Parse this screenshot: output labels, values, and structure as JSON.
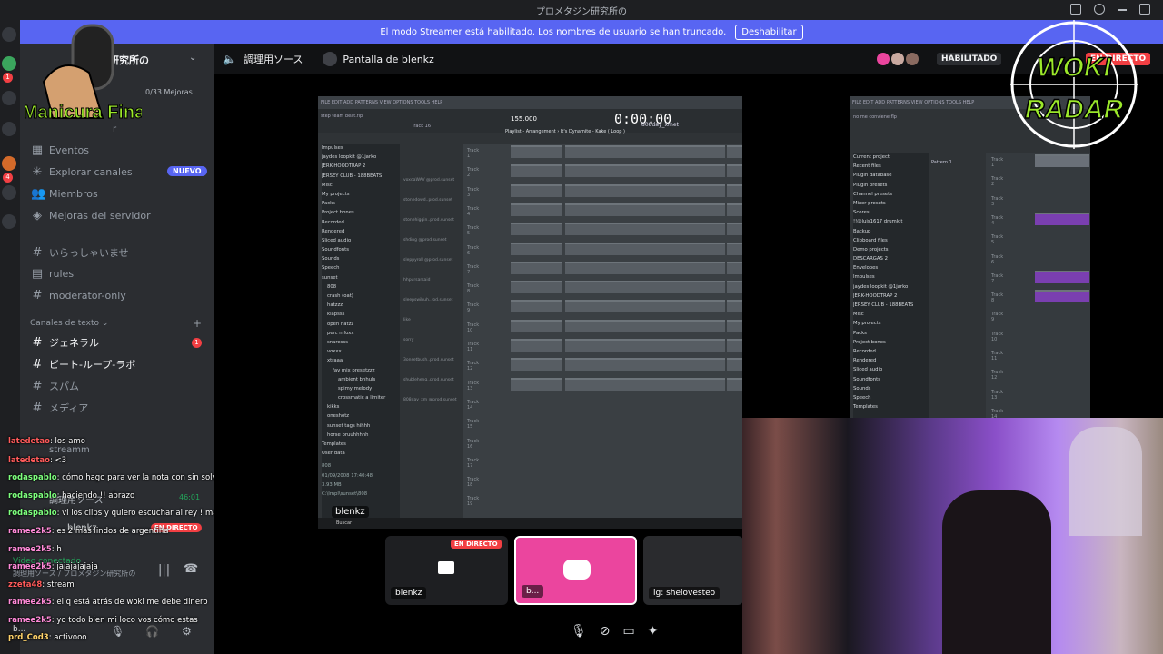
{
  "window": {
    "title": "プロメタジン研究所の"
  },
  "streamer_banner": {
    "text": "El modo Streamer está habilitado. Los nombres de usuario se han truncado.",
    "button": "Deshabilitar"
  },
  "server_badges": {
    "unread1": "1",
    "unread4": "4"
  },
  "server": {
    "name": "研究所の",
    "boosts": "0/33 Mejoras",
    "guide_partial": "r"
  },
  "sidebar": {
    "items": [
      {
        "label": "Eventos",
        "icon": "calendar-icon"
      },
      {
        "label": "Explorar canales",
        "icon": "compass-icon",
        "badge": "NUEVO"
      },
      {
        "label": "Miembros",
        "icon": "members-icon"
      },
      {
        "label": "Mejoras del servidor",
        "icon": "boost-icon"
      }
    ],
    "channels_top": [
      "いらっしゃいませ",
      "rules",
      "moderator-only"
    ],
    "category": "Canales de texto",
    "text_channels": [
      {
        "name": "ジェネラル",
        "mentions": "1"
      },
      {
        "name": "ビート-ループ-ラボ"
      },
      {
        "name": "スパム"
      },
      {
        "name": "メディア"
      }
    ],
    "voice_name": "調理用ソース",
    "voice_timer": "46:01",
    "voice_user": "blenkz",
    "live_badge": "EN DIRECTO",
    "stream_user": "streamm"
  },
  "voice_panel": {
    "status": "Video conectado",
    "channel": "調理用ソース / プロメタジン研究所の",
    "self_short": "b..."
  },
  "chat": [
    {
      "user": "latedetao",
      "msg": "los amo"
    },
    {
      "user": "latedetao",
      "msg": "<3"
    },
    {
      "user": "rodaspablo",
      "msg": "cómo hago para ver la nota con sin solvente?"
    },
    {
      "user": "rodaspablo",
      "msg": "haciendo !! abrazo"
    },
    {
      "user": "rodaspablo",
      "msg": "vi los clips y quiero escuchar al rey ! máquina Cristian"
    },
    {
      "user": "ramee2k5",
      "msg": "es 2 más lindos de argentina"
    },
    {
      "user": "ramee2k5",
      "msg": "h"
    },
    {
      "user": "ramee2k5",
      "msg": "jajajajajaja"
    },
    {
      "user": "zzeta48",
      "msg": "stream"
    },
    {
      "user": "ramee2k5",
      "msg": "el q está atrás de woki me debe dinero"
    },
    {
      "user": "ramee2k5",
      "msg": "yo todo bien mi loco vos cómo estas"
    },
    {
      "user": "prd_Cod3",
      "msg": "activooo"
    }
  ],
  "topbar": {
    "voice_channel": "調理用ソース",
    "stream_title": "Pantalla de blenkz",
    "status": "HABILITADO",
    "live": "EN DIRECTO"
  },
  "daw": {
    "menu": "FILE EDIT ADD PATTERNS VIEW OPTIONS TOOLS HELP",
    "bpm": "155.000",
    "time": "0:00:00",
    "project": "step team beat.flp",
    "track": "Track 16",
    "playlist_title": "Playlist - Arrangement › It's Dynamite - Kake ( Loop )",
    "pattern": "808day_xmet",
    "browser": [
      "Impulses",
      "jaydes loopkit @1jarko",
      "JERK-HOODTRAP 2",
      "JERSEY CLUB - 188BEATS",
      "Misc",
      "My projects",
      "Packs",
      "Project bones",
      "Recorded",
      "Rendered",
      "Sliced audio",
      "Soundfonts",
      "Sounds",
      "Speech",
      "sunset",
      "808",
      "crash (oat)",
      "hatzzz",
      "klapsss",
      "open hatzz",
      "perc n foxx",
      "snaresss",
      "voxxx",
      "xtraaa",
      "fav mix presetzzz",
      "ambient bhhuls",
      "spimy melody",
      "crossmatic a limiter",
      "kikks",
      "oneshotz",
      "sunset tags hihhh",
      "horse bruuhhhhh",
      "Templates",
      "User data"
    ],
    "patterns": [
      "voxdaWAV @prod.sunset",
      "stonedowd..prod.sunset",
      "stonehiggin..prod.sunset",
      "shding @prod.sunset",
      "sleppyroll @prod.sunset",
      "hhpursarsaid",
      "sleepswihuh..rod.sunset",
      "like",
      "sorry",
      "3onsetbush..prod.sunset",
      "shubleheng..prod.sunset",
      "808day_xm @prod.sunset"
    ],
    "tracks": [
      "Track 1",
      "Track 2",
      "Track 3",
      "Track 4",
      "Track 5",
      "Track 6",
      "Track 7",
      "Track 8",
      "Track 9",
      "Track 10",
      "Track 11",
      "Track 12",
      "Track 13",
      "Track 14",
      "Track 15",
      "Track 16",
      "Track 17",
      "Track 18",
      "Track 19"
    ],
    "info": {
      "title": "808",
      "date": "01/09/2008 17:40:48",
      "size": "3.93 MB",
      "path": "C:\\Impl\\sunset\\808"
    },
    "taskbar_search": "Buscar"
  },
  "daw2": {
    "menu": "FILE EDIT ADD PATTERNS VIEW OPTIONS TOOLS HELP",
    "project": "no me conviene.flp",
    "pattern": "Pattern 1",
    "browser": [
      "Current project",
      "Recent files",
      "Plugin database",
      "Plugin presets",
      "Channel presets",
      "Mixer presets",
      "Scores",
      "!!@luis1617 drumkit",
      "Backup",
      "Clipboard files",
      "Demo projects",
      "DESCARGAS 2",
      "Envelopes",
      "Impulses",
      "jaydes loopkit @1jarko",
      "JERK-HOODTRAP 2",
      "JERSEY CLUB - 188BEATS",
      "Misc",
      "My projects",
      "Packs",
      "Project bones",
      "Recorded",
      "Rendered",
      "Sliced audio",
      "Soundfonts",
      "Sounds",
      "Speech",
      "Templates"
    ],
    "tracks": [
      "Track 1",
      "Track 2",
      "Track 3",
      "Track 4",
      "Track 5",
      "Track 6",
      "Track 7",
      "Track 8",
      "Track 9",
      "Track 10",
      "Track 11",
      "Track 12",
      "Track 13",
      "Track 14"
    ],
    "clip_label": "no me conviene_2306"
  },
  "tiles": [
    {
      "label": "blenkz",
      "live": "EN DIRECTO"
    },
    {
      "label": "b..."
    },
    {
      "label": "lg: shelovesteo"
    }
  ],
  "stage_label": "blenkz",
  "logos": {
    "left": "Manicura Fina",
    "right_line1": "WOKI",
    "right_line2": "RADAR"
  },
  "colors": {
    "blurple": "#5865f2",
    "live": "#f23f43",
    "discord_tile": "#eb459e",
    "background": "#111214"
  }
}
